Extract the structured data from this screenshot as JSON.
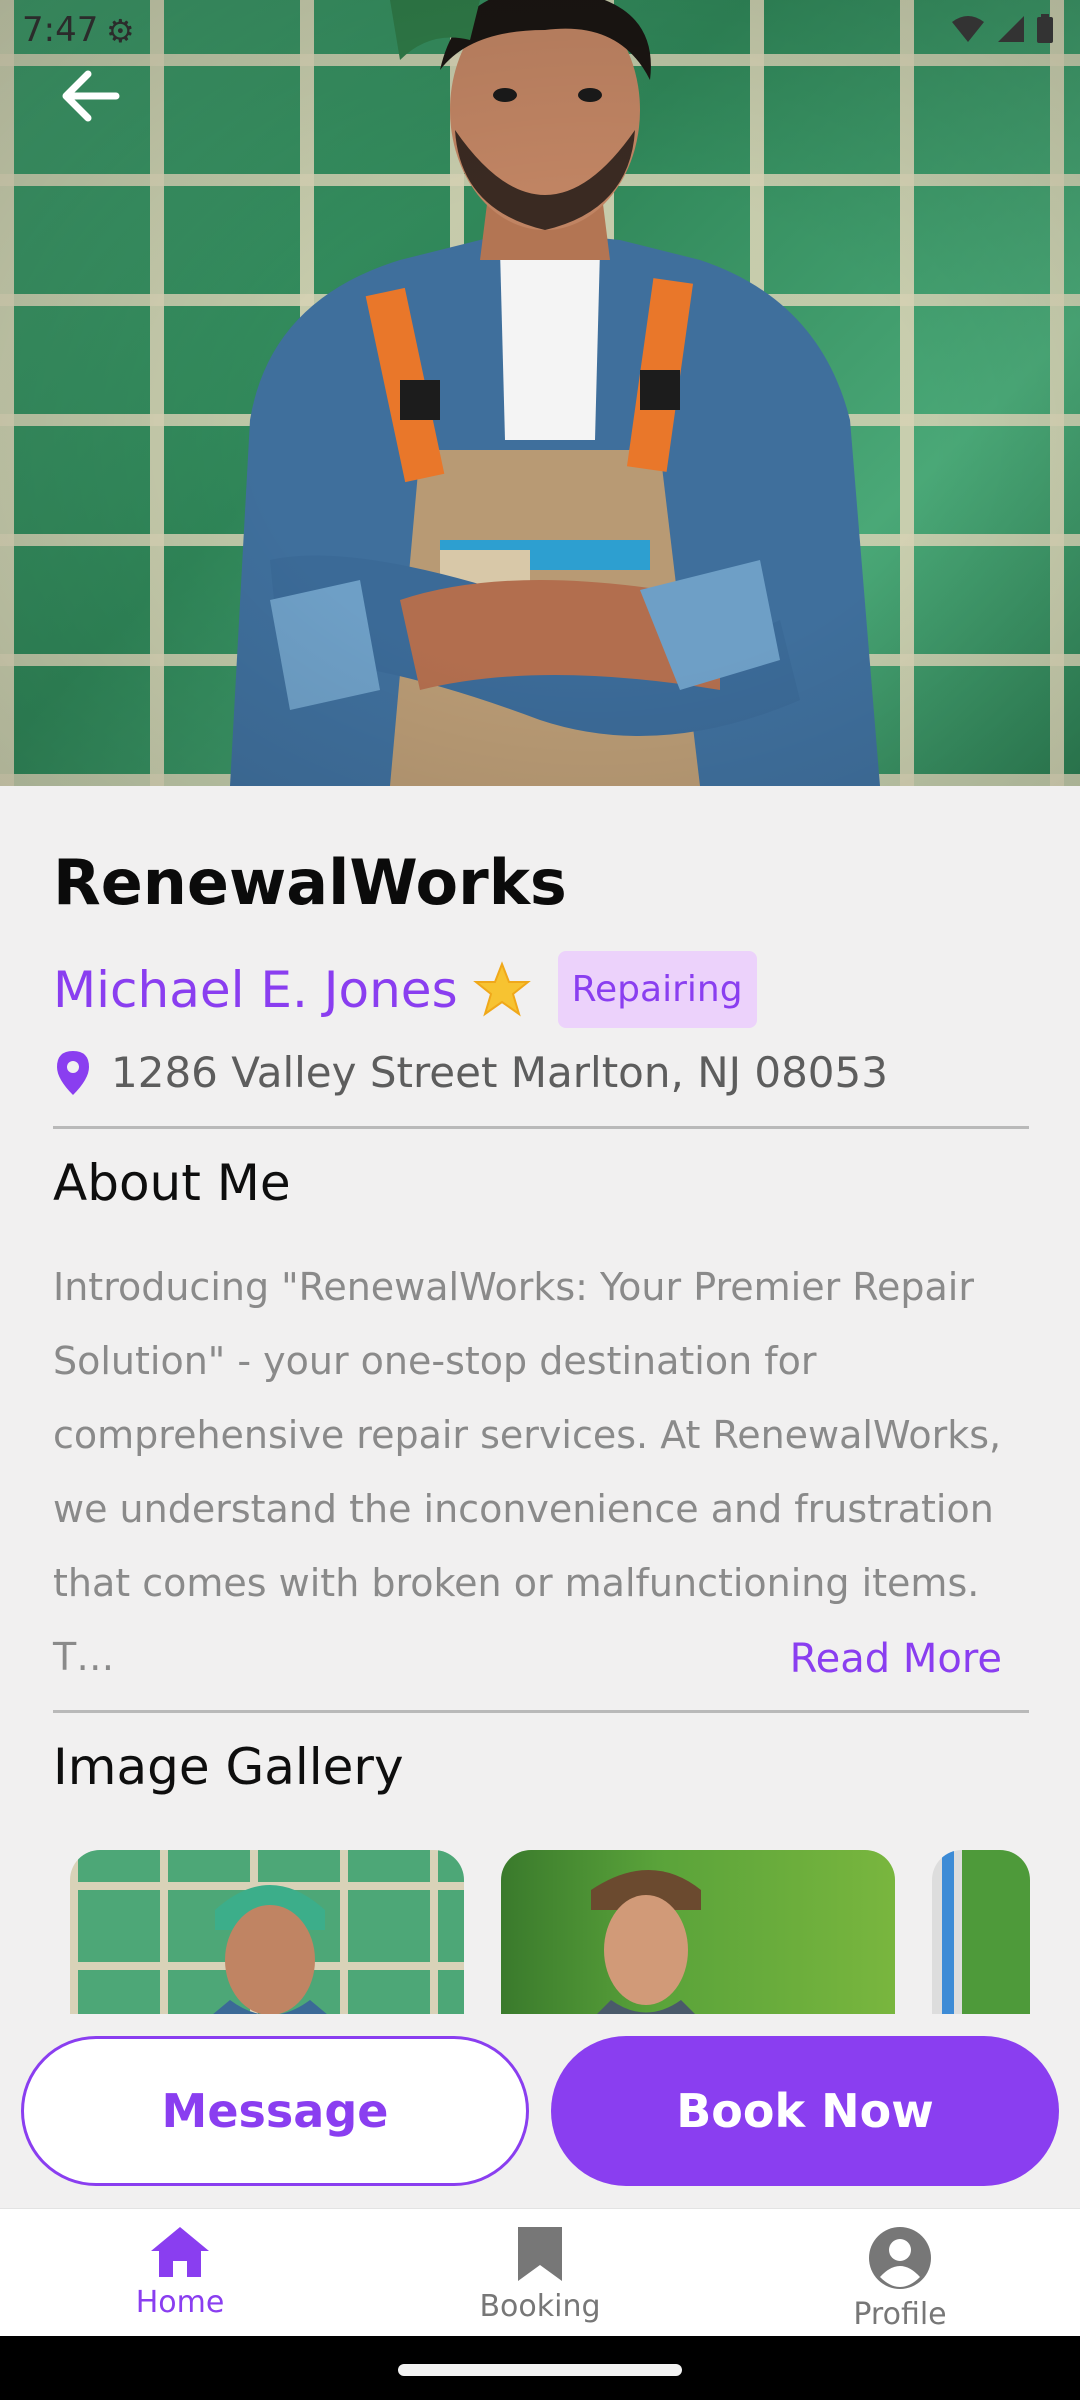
{
  "status_bar": {
    "time": "7:47"
  },
  "header": {
    "back_icon": "arrow-left-icon"
  },
  "business": {
    "title": "RenewalWorks",
    "owner_name": "Michael E. Jones",
    "category_tag": "Repairing",
    "address": "1286 Valley Street Marlton, NJ 08053"
  },
  "about": {
    "heading": "About Me",
    "text": "Introducing \"RenewalWorks: Your Premier Repair Solution\" - your one-stop destination for comprehensive repair services. At RenewalWorks, we understand the inconvenience and frustration that comes with broken or malfunctioning items. T…",
    "read_more": "Read More"
  },
  "gallery": {
    "heading": "Image Gallery"
  },
  "actions": {
    "message_label": "Message",
    "book_label": "Book Now"
  },
  "nav": {
    "items": [
      {
        "label": "Home",
        "icon": "home-icon",
        "active": true
      },
      {
        "label": "Booking",
        "icon": "bookmark-icon",
        "active": false
      },
      {
        "label": "Profile",
        "icon": "profile-icon",
        "active": false
      }
    ]
  },
  "colors": {
    "accent": "#8a3ef0",
    "tag_bg": "#ecd2fb",
    "page_bg": "#f1f0f0"
  }
}
